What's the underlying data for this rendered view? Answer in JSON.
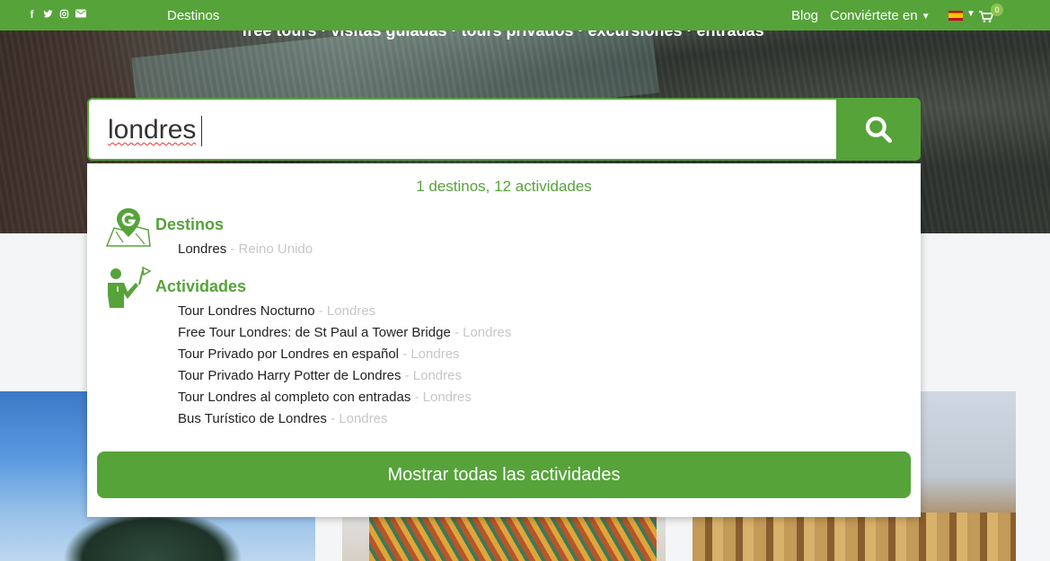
{
  "hero": {
    "tagline": "free tours · visitas guiadas · tours privados · excursiones · entradas"
  },
  "topbar": {
    "social_icons": [
      "facebook-icon",
      "twitter-icon",
      "instagram-icon",
      "mail-icon"
    ],
    "destinos_label": "Destinos",
    "blog_label": "Blog",
    "become_label": "Conviértete en",
    "language_flag": "es-flag-icon",
    "cart_count": "0",
    "colors": {
      "bar": "#56a33a",
      "badge": "#8bc34a"
    }
  },
  "search": {
    "value": "londres",
    "button_icon": "search-icon"
  },
  "dropdown": {
    "summary": "1 destinos, 12 actividades",
    "destinos": {
      "title": "Destinos",
      "icon": "map-pin-icon",
      "items": [
        {
          "name": "Londres",
          "sub": " - Reino Unido"
        }
      ]
    },
    "actividades": {
      "title": "Actividades",
      "icon": "guide-icon",
      "items": [
        {
          "name": "Tour Londres Nocturno",
          "sub": " - Londres"
        },
        {
          "name": "Free Tour Londres: de St Paul a Tower Bridge",
          "sub": " - Londres"
        },
        {
          "name": "Tour Privado por Londres en español",
          "sub": " - Londres"
        },
        {
          "name": "Tour Privado Harry Potter de Londres",
          "sub": " - Londres"
        },
        {
          "name": "Tour Londres al completo con entradas",
          "sub": " - Londres"
        },
        {
          "name": "Bus Turístico de Londres",
          "sub": " - Londres"
        }
      ]
    },
    "show_all_label": "Mostrar todas las actividades"
  }
}
